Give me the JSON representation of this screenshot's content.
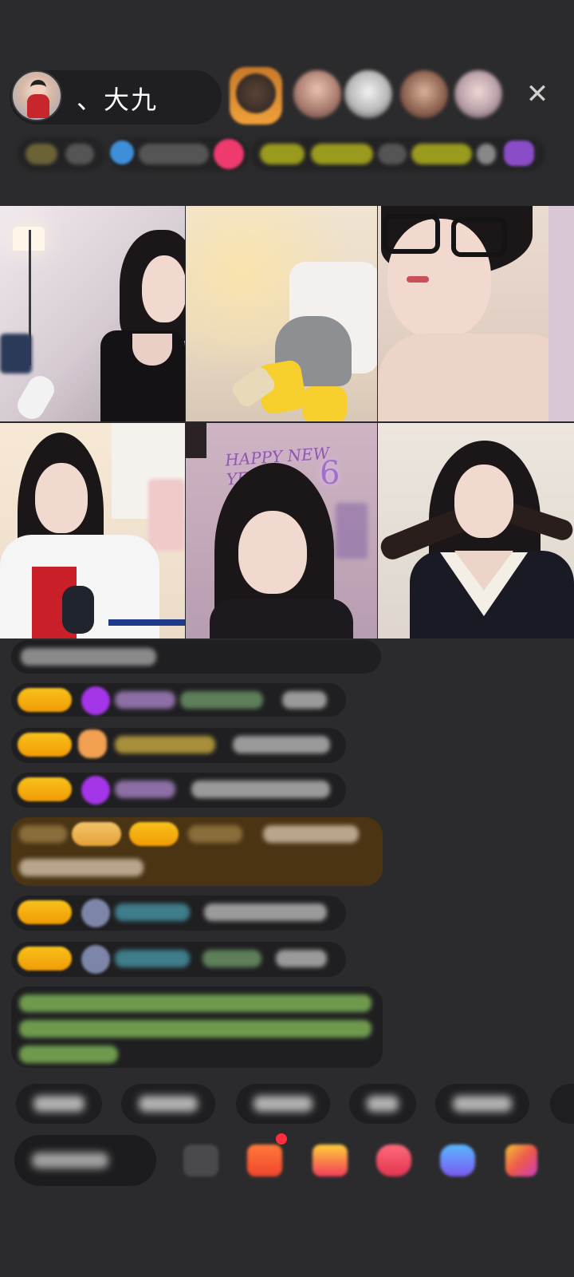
{
  "host": {
    "name": "、大九"
  },
  "top_bar": {
    "close_icon": "close-icon",
    "viewer_avatar_count": 5
  },
  "grid": {
    "tiles": [
      {
        "id": "guest-1"
      },
      {
        "id": "guest-2"
      },
      {
        "id": "guest-3"
      },
      {
        "id": "guest-4"
      },
      {
        "id": "guest-5"
      },
      {
        "id": "guest-6"
      }
    ],
    "tile5_overlay": "HAPPY NEW YEAR"
  },
  "colors": {
    "background": "#2b2b2d",
    "level_badge": "#f5b010",
    "gem_purple": "#a435e8",
    "system_text_green": "#9bd16a",
    "red_dot": "#ff2d3d"
  },
  "bottom_bar": {
    "icons": [
      "emoji-icon",
      "gift-box-icon",
      "treasure-icon",
      "fan-club-icon",
      "game-icon",
      "more-apps-icon"
    ]
  }
}
